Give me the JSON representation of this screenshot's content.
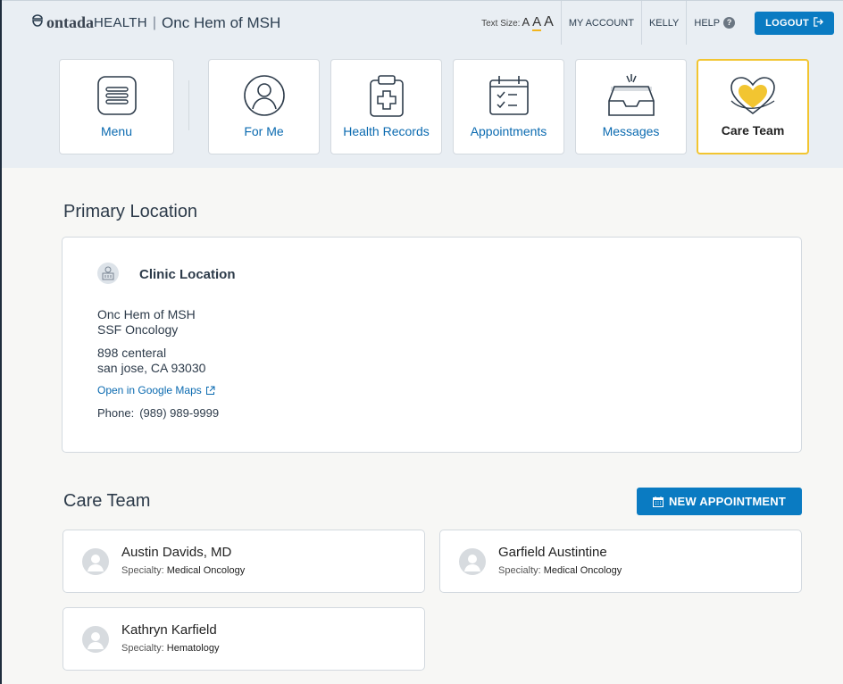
{
  "header": {
    "brand_bold": "ontada",
    "brand_light": "HEALTH",
    "org": "Onc Hem of MSH",
    "text_size_label": "Text Size:",
    "text_size_options": [
      "A",
      "A",
      "A"
    ],
    "nav": [
      "MY ACCOUNT",
      "KELLY",
      "HELP"
    ],
    "logout_label": "LOGOUT"
  },
  "tiles": [
    {
      "label": "Menu",
      "icon": "menu-icon"
    },
    {
      "label": "For Me",
      "icon": "user-icon"
    },
    {
      "label": "Health Records",
      "icon": "clipboard-icon"
    },
    {
      "label": "Appointments",
      "icon": "calendar-check-icon"
    },
    {
      "label": "Messages",
      "icon": "inbox-icon"
    },
    {
      "label": "Care Team",
      "icon": "heart-icon",
      "active": true
    }
  ],
  "primary_location": {
    "heading": "Primary Location",
    "card_title": "Clinic Location",
    "name": "Onc Hem of MSH",
    "department": "SSF Oncology",
    "address1": "898 centeral",
    "address2": "san jose, CA 93030",
    "maps_link": "Open in Google Maps",
    "phone_label": "Phone:",
    "phone": "(989) 989-9999"
  },
  "care_team": {
    "heading": "Care Team",
    "new_appointment_label": "NEW APPOINTMENT",
    "specialty_label": "Specialty:",
    "members": [
      {
        "name": "Austin Davids, MD",
        "specialty": "Medical Oncology"
      },
      {
        "name": "Garfield Austintine",
        "specialty": "Medical Oncology"
      },
      {
        "name": "Kathryn Karfield",
        "specialty": "Hematology"
      }
    ]
  },
  "colors": {
    "accent_blue": "#0a7bc2",
    "link_blue": "#0a6ab0",
    "active_yellow": "#f2c531",
    "header_bg": "#e9eef3"
  }
}
